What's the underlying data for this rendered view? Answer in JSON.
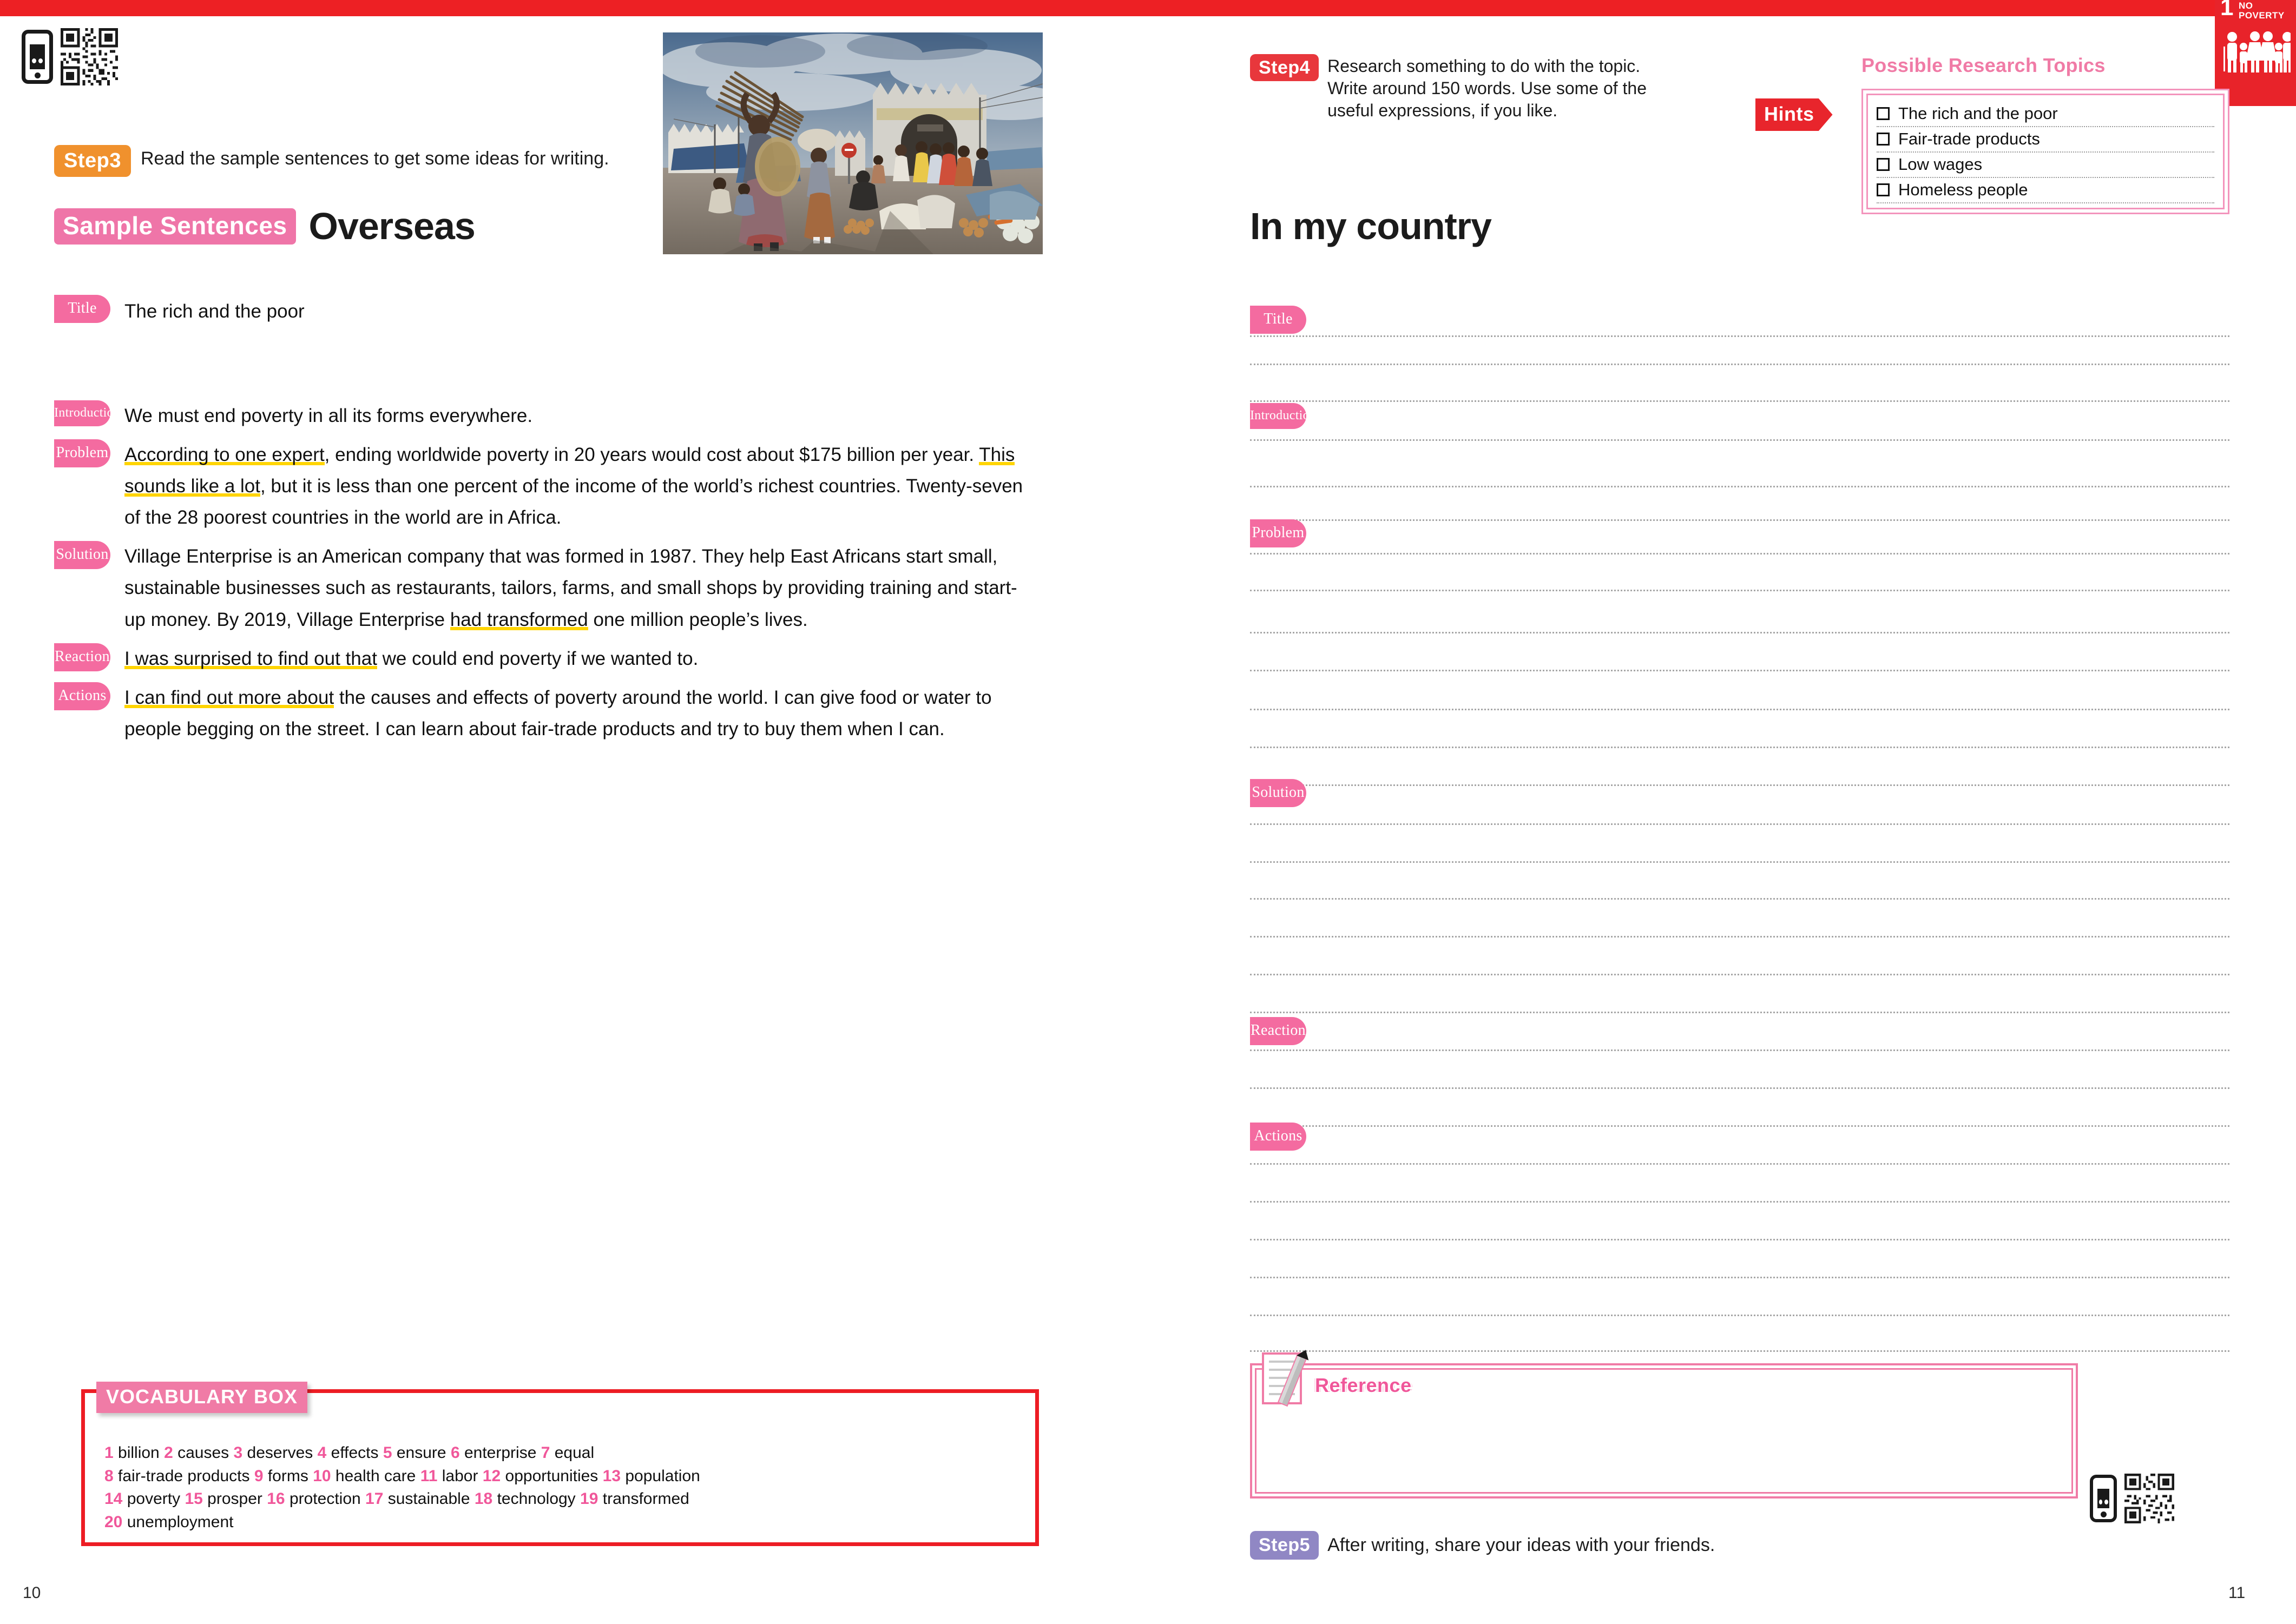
{
  "banner": {
    "sdg_number": "1",
    "sdg_label_line1": "NO",
    "sdg_label_line2": "POVERTY"
  },
  "left_page": {
    "page_number": "10",
    "step": {
      "badge": "Step3",
      "text": "Read the sample sentences to get some ideas for writing."
    },
    "sample_tag": "Sample Sentences",
    "heading": "Overseas",
    "title_label": "Title",
    "title_value": "The rich and the poor",
    "sections": [
      {
        "label": "Introduction",
        "parts": [
          {
            "t": "We must end poverty in all its forms everywhere.",
            "hl": false
          }
        ]
      },
      {
        "label": "Problem",
        "parts": [
          {
            "t": "According to one expert",
            "hl": true
          },
          {
            "t": ", ending worldwide poverty in 20 years would cost about $175 billion per year. ",
            "hl": false
          },
          {
            "t": "This sounds like a lot",
            "hl": true
          },
          {
            "t": ", but it is less than one percent of the income of the world’s richest countries. Twenty-seven of the 28 poorest countries in the world are in Africa.",
            "hl": false
          }
        ]
      },
      {
        "label": "Solution",
        "parts": [
          {
            "t": "Village Enterprise is an American company that was formed in 1987. They help East Africans start small, sustainable businesses such as restaurants, tailors, farms, and small shops by providing training and start-up money. By 2019, Village Enterprise ",
            "hl": false
          },
          {
            "t": "had transformed",
            "hl": true
          },
          {
            "t": " one million people’s lives.",
            "hl": false
          }
        ]
      },
      {
        "label": "Reaction",
        "parts": [
          {
            "t": "I was surprised to find out that",
            "hl": true
          },
          {
            "t": " we could end poverty if we wanted to.",
            "hl": false
          }
        ]
      },
      {
        "label": "Actions",
        "parts": [
          {
            "t": "I can find out more about",
            "hl": true
          },
          {
            "t": " the causes and effects of poverty around the world. I can give food or water to people begging on the street. I can learn about fair-trade products and try to buy them when I can.",
            "hl": false
          }
        ]
      }
    ],
    "vocabulary": {
      "title": "VOCABULARY BOX",
      "lines": [
        [
          {
            "n": "1",
            "w": "billion"
          },
          {
            "n": "2",
            "w": "causes"
          },
          {
            "n": "3",
            "w": "deserves"
          },
          {
            "n": "4",
            "w": "effects"
          },
          {
            "n": "5",
            "w": "ensure"
          },
          {
            "n": "6",
            "w": "enterprise"
          },
          {
            "n": "7",
            "w": "equal"
          }
        ],
        [
          {
            "n": "8",
            "w": "fair-trade products"
          },
          {
            "n": "9",
            "w": "forms"
          },
          {
            "n": "10",
            "w": "health care"
          },
          {
            "n": "11",
            "w": "labor"
          },
          {
            "n": "12",
            "w": "opportunities"
          },
          {
            "n": "13",
            "w": "population"
          }
        ],
        [
          {
            "n": "14",
            "w": "poverty"
          },
          {
            "n": "15",
            "w": "prosper"
          },
          {
            "n": "16",
            "w": "protection"
          },
          {
            "n": "17",
            "w": "sustainable"
          },
          {
            "n": "18",
            "w": "technology"
          },
          {
            "n": "19",
            "w": "transformed"
          }
        ],
        [
          {
            "n": "20",
            "w": "unemployment"
          }
        ]
      ]
    }
  },
  "right_page": {
    "page_number": "11",
    "step": {
      "badge": "Step4",
      "text": "Research something to do with the topic. Write around 150 words. Use some of the useful expressions, if you like."
    },
    "heading": "In my country",
    "hints_badge": "Hints",
    "research_topics": {
      "title": "Possible Research Topics",
      "items": [
        "The rich and the poor",
        "Fair-trade products",
        "Low wages",
        "Homeless people"
      ]
    },
    "section_labels": [
      "Title",
      "Introduction",
      "Problem",
      "Solution",
      "Reaction",
      "Actions"
    ],
    "reference_label": "Reference",
    "step5": {
      "badge": "Step5",
      "text": "After writing, share your ideas with your friends."
    }
  },
  "colors": {
    "red": "#ed2024",
    "pink": "#f46ba0",
    "pink_light": "#f07ba6",
    "orange": "#f0912d",
    "purple": "#9087c4",
    "highlight_yellow": "#ffd400"
  }
}
